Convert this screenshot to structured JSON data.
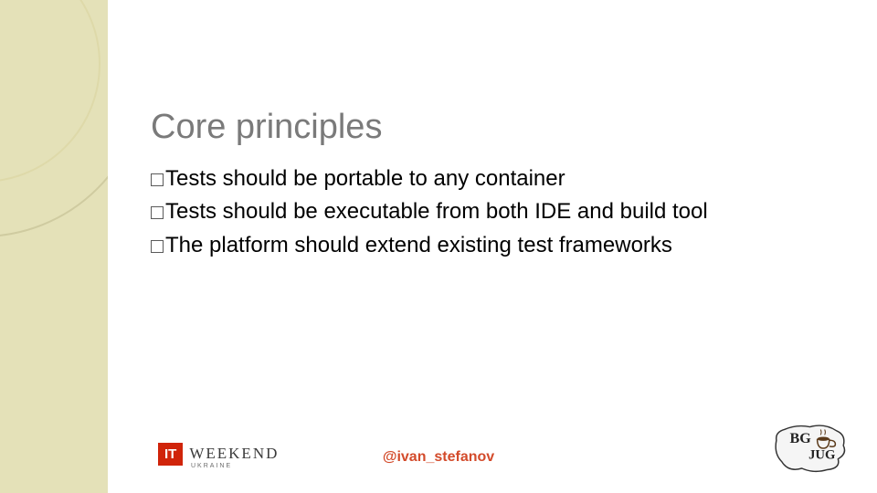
{
  "title": "Core principles",
  "bullets": [
    "Tests should be portable to any container",
    "Tests should be executable from both IDE and build tool",
    "The platform should extend existing test frameworks"
  ],
  "footer": {
    "handle": "@ivan_stefanov"
  },
  "logos": {
    "itw_it": "IT",
    "itw_weekend": "WEEKEND",
    "itw_ukraine": "UKRAINE",
    "bgjug_bg": "BG",
    "bgjug_jug": "JUG"
  }
}
